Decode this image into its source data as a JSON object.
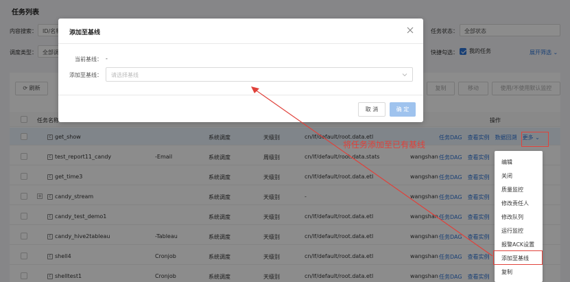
{
  "page": {
    "title": "任务列表"
  },
  "filters": {
    "content_search_label": "内容搜索：",
    "content_search_value": "ID/名称",
    "schedule_type_label": "调度类型：",
    "schedule_type_value": "全部调",
    "task_status_label": "任务状态：",
    "task_status_value": "全部状态",
    "quick_check_label": "快捷勾选：",
    "my_tasks_label": "我的任务",
    "expand_filter_label": "展开筛选"
  },
  "toolbar": {
    "refresh_label": "刷新",
    "copy_label": "复制",
    "move_label": "移动",
    "default_monitor_label": "使用/不使用默认监控"
  },
  "table": {
    "col_task_name": "任务名称",
    "col_ops": "操作",
    "rows": [
      {
        "name": "get_show",
        "tool": "",
        "schedule": "系统调度",
        "level": "天级别",
        "path": "cn/lf/default/root.data.etl",
        "owner": "",
        "highlight": true,
        "expand": false
      },
      {
        "name": "test_report11_candy",
        "tool": "-Email",
        "schedule": "系统调度",
        "level": "周级别",
        "path": "cn/lf/default/root.data.stats",
        "owner": "wangshan",
        "highlight": false,
        "expand": false
      },
      {
        "name": "get_time3",
        "tool": "",
        "schedule": "系统调度",
        "level": "天级别",
        "path": "cn/lf/default/root.data.etl",
        "owner": "wangshan",
        "highlight": false,
        "expand": false
      },
      {
        "name": "candy_stream",
        "tool": "",
        "schedule": "系统调度",
        "level": "天级别",
        "path": "-",
        "owner": "wangshan",
        "highlight": false,
        "expand": true
      },
      {
        "name": "candy_test_demo1",
        "tool": "",
        "schedule": "系统调度",
        "level": "天级别",
        "path": "cn/lf/default/root.data.etl",
        "owner": "wangshan",
        "highlight": false,
        "expand": false
      },
      {
        "name": "candy_hive2tableau",
        "tool": "-Tableau",
        "schedule": "系统调度",
        "level": "天级别",
        "path": "cn/lf/default/root.data.etl",
        "owner": "wangshan",
        "highlight": false,
        "expand": false
      },
      {
        "name": "shell4",
        "tool": "Cronjob",
        "schedule": "系统调度",
        "level": "天级别",
        "path": "cn/lf/default/root.data.etl",
        "owner": "wangshan",
        "highlight": false,
        "expand": false
      },
      {
        "name": "shelltest1",
        "tool": "Cronjob",
        "schedule": "系统调度",
        "level": "天级别",
        "path": "cn/lf/default/root.data.etl",
        "owner": "wangshan",
        "highlight": false,
        "expand": false
      }
    ],
    "op_dag": "任务DAG",
    "op_instance": "查看实例",
    "op_backfill": "数据回溯",
    "op_more": "更多"
  },
  "dropdown": {
    "items": [
      "编辑",
      "关闭",
      "质量监控",
      "修改责任人",
      "修改队列",
      "运行监控",
      "报警ACK设置",
      "添加至基线",
      "复制"
    ]
  },
  "modal": {
    "title": "添加至基线",
    "current_baseline_label": "当前基线：",
    "current_baseline_value": "-",
    "add_to_baseline_label": "添加至基线：",
    "select_placeholder": "请选择基线",
    "cancel_label": "取 消",
    "confirm_label": "确 定"
  },
  "annotation": {
    "text": "将任务添加至已有基线"
  },
  "colors": {
    "primary": "#2f75d6",
    "annotation_red": "#e0413a"
  }
}
